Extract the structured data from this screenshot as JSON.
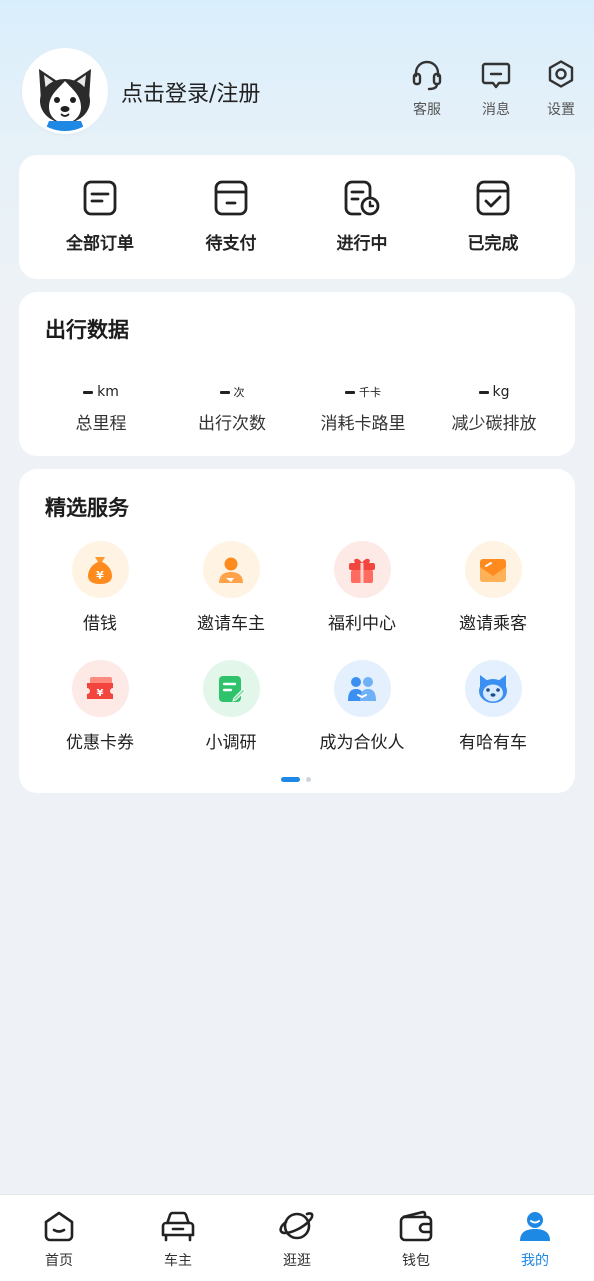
{
  "header": {
    "login_label": "点击登录/注册",
    "actions": [
      {
        "label": "客服",
        "icon": "headset-icon"
      },
      {
        "label": "消息",
        "icon": "message-icon"
      },
      {
        "label": "设置",
        "icon": "settings-icon"
      }
    ]
  },
  "orders": [
    {
      "label": "全部订单",
      "icon": "document-icon"
    },
    {
      "label": "待支付",
      "icon": "wallet-pending-icon"
    },
    {
      "label": "进行中",
      "icon": "clock-document-icon"
    },
    {
      "label": "已完成",
      "icon": "check-box-icon"
    }
  ],
  "travel_data": {
    "title": "出行数据",
    "stats": [
      {
        "unit": "km",
        "label": "总里程"
      },
      {
        "unit": "次",
        "label": "出行次数"
      },
      {
        "unit": "千卡",
        "label": "消耗卡路里"
      },
      {
        "unit": "kg",
        "label": "减少碳排放"
      }
    ]
  },
  "services": {
    "title": "精选服务",
    "items": [
      {
        "label": "借钱",
        "icon": "money-bag-icon",
        "color": "#ff8a1e"
      },
      {
        "label": "邀请车主",
        "icon": "invite-driver-icon",
        "color": "#ff8a1e"
      },
      {
        "label": "福利中心",
        "icon": "gift-icon",
        "color": "#f2453d"
      },
      {
        "label": "邀请乘客",
        "icon": "envelope-icon",
        "color": "#ff8a1e"
      },
      {
        "label": "优惠卡券",
        "icon": "coupon-icon",
        "color": "#f2453d"
      },
      {
        "label": "小调研",
        "icon": "survey-icon",
        "color": "#2ec26a"
      },
      {
        "label": "成为合伙人",
        "icon": "partners-icon",
        "color": "#3a8ff0"
      },
      {
        "label": "有哈有车",
        "icon": "husky-face-icon",
        "color": "#3a8ff0"
      }
    ]
  },
  "tabs": [
    {
      "label": "首页",
      "icon": "home-icon",
      "active": false
    },
    {
      "label": "车主",
      "icon": "car-icon",
      "active": false
    },
    {
      "label": "逛逛",
      "icon": "planet-icon",
      "active": false
    },
    {
      "label": "钱包",
      "icon": "wallet-icon",
      "active": false
    },
    {
      "label": "我的",
      "icon": "user-icon",
      "active": true
    }
  ],
  "colors": {
    "accent": "#1e88e5",
    "text": "#222222",
    "background": "#eef2f6"
  }
}
